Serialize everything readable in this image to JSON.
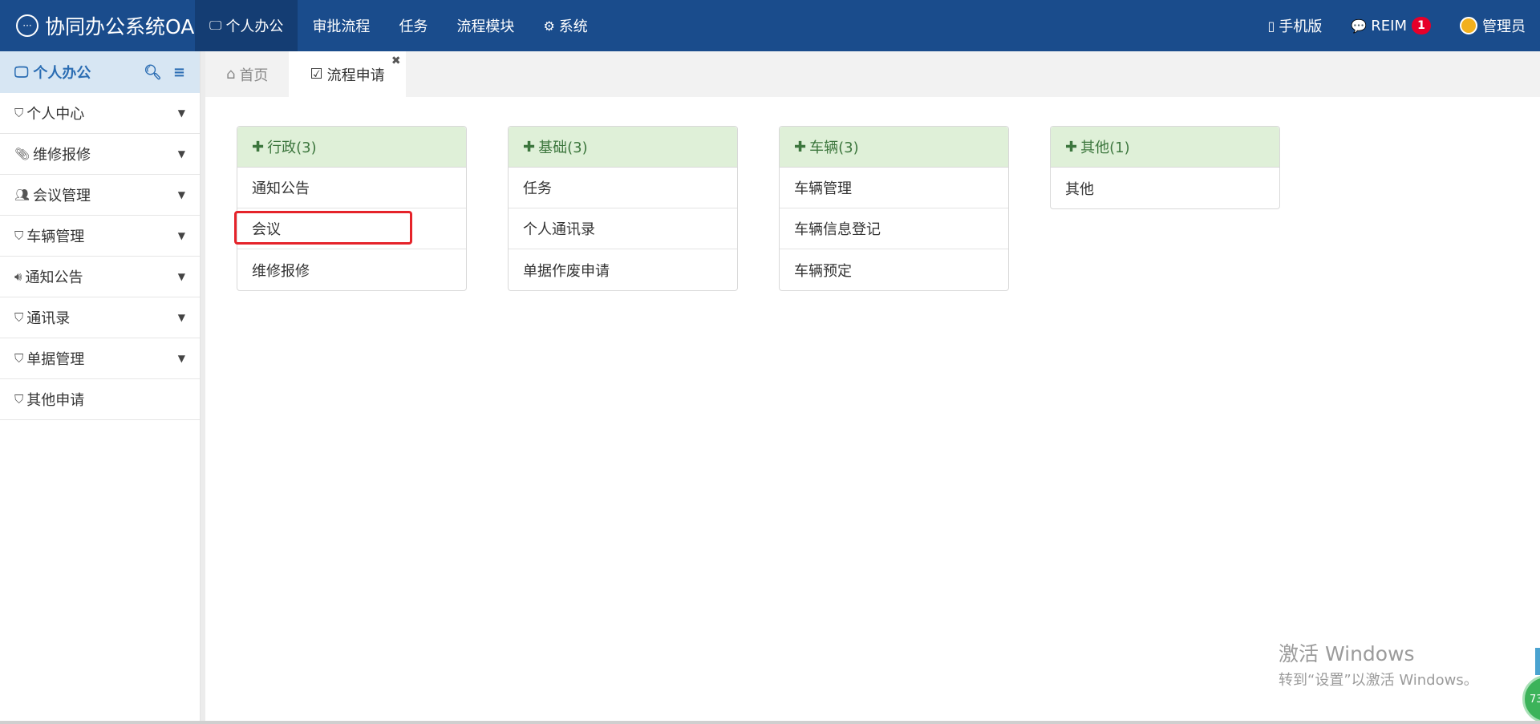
{
  "navbar": {
    "brand": "协同办公系统OA",
    "items": [
      {
        "label": "个人办公",
        "icon": "monitor-icon",
        "active": true
      },
      {
        "label": "审批流程"
      },
      {
        "label": "任务"
      },
      {
        "label": "流程模块"
      },
      {
        "label": "系统",
        "icon": "gear-icon"
      }
    ],
    "mobile_label": "手机版",
    "reim_label": "REIM",
    "reim_badge": "1",
    "user_label": "管理员"
  },
  "sidebar": {
    "title": "个人办公",
    "items": [
      {
        "label": "个人中心",
        "icon": "bookmark-icon",
        "has_caret": true
      },
      {
        "label": "维修报修",
        "icon": "paperclip-icon",
        "has_caret": true
      },
      {
        "label": "会议管理",
        "icon": "users-icon",
        "has_caret": true
      },
      {
        "label": "车辆管理",
        "icon": "bookmark-icon",
        "has_caret": true
      },
      {
        "label": "通知公告",
        "icon": "volume-icon",
        "has_caret": true
      },
      {
        "label": "通讯录",
        "icon": "bookmark-icon",
        "has_caret": true
      },
      {
        "label": "单据管理",
        "icon": "bookmark-icon",
        "has_caret": true
      },
      {
        "label": "其他申请",
        "icon": "bookmark-icon",
        "has_caret": false
      }
    ]
  },
  "tabs": [
    {
      "label": "首页",
      "icon": "home-icon",
      "active": false
    },
    {
      "label": "流程申请",
      "icon": "check-square-icon",
      "active": true
    }
  ],
  "panels": [
    {
      "title": "行政(3)",
      "rows": [
        "通知公告",
        "会议",
        "维修报修"
      ],
      "highlight_row": 1
    },
    {
      "title": "基础(3)",
      "rows": [
        "任务",
        "个人通讯录",
        "单据作废申请"
      ]
    },
    {
      "title": "车辆(3)",
      "rows": [
        "车辆管理",
        "车辆信息登记",
        "车辆预定"
      ]
    },
    {
      "title": "其他(1)",
      "rows": [
        "其他"
      ]
    }
  ],
  "watermark": {
    "title": "激活 Windows",
    "subtitle": "转到“设置”以激活 Windows。"
  },
  "corner_badge": "73",
  "colors": {
    "navbar": "#1a4c8c",
    "panel_head": "#dff0d8",
    "panel_text": "#3c763d",
    "highlight": "#e5232a",
    "badge": "#e6002a"
  }
}
